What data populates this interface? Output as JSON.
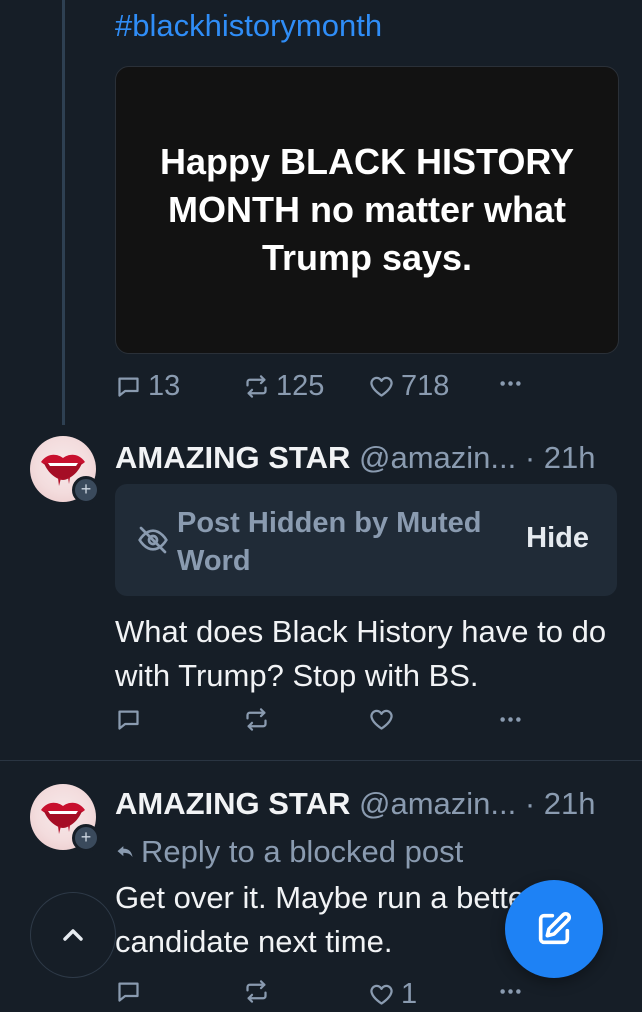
{
  "parent_post": {
    "hashtag": "#blackhistorymonth",
    "image_text": "Happy BLACK HISTORY MONTH no matter what Trump says.",
    "reply_count": "13",
    "repost_count": "125",
    "like_count": "718"
  },
  "post1": {
    "name": "AMAZING STAR",
    "handle": "@amazin...",
    "time": "· 21h",
    "hidden_label": "Post Hidden by Muted Word",
    "hide_button": "Hide",
    "text": "What does Black History have to do with Trump? Stop with BS."
  },
  "post2": {
    "name": "AMAZING STAR",
    "handle": "@amazin...",
    "time": "· 21h",
    "reply_to": "Reply to a blocked post",
    "text": "Get over it. Maybe run a better candidate next time.",
    "like_count": "1"
  },
  "icons": {
    "reply": "reply-icon",
    "repost": "repost-icon",
    "like": "heart-icon",
    "more": "more-icon",
    "compose": "compose-icon",
    "scroll_top": "chevron-up-icon"
  },
  "colors": {
    "background": "#161e27",
    "accent": "#1e82f5",
    "link": "#2f8df7",
    "muted": "#8a9bb0"
  }
}
